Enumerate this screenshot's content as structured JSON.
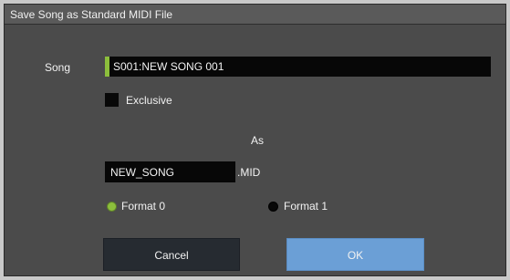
{
  "dialog": {
    "title": "Save Song as Standard MIDI File",
    "song_label": "Song",
    "song_value": "S001:NEW SONG 001",
    "exclusive_label": "Exclusive",
    "exclusive_checked": false,
    "as_label": "As",
    "filename_value": "NEW_SONG",
    "extension": ".MID",
    "format0_label": "Format 0",
    "format1_label": "Format 1",
    "selected_format": "Format 0",
    "cancel_label": "Cancel",
    "ok_label": "OK"
  },
  "colors": {
    "accent_green": "#8cbe3c",
    "ok_blue": "#6b9fd6",
    "dialog_bg": "#4b4b4b"
  }
}
